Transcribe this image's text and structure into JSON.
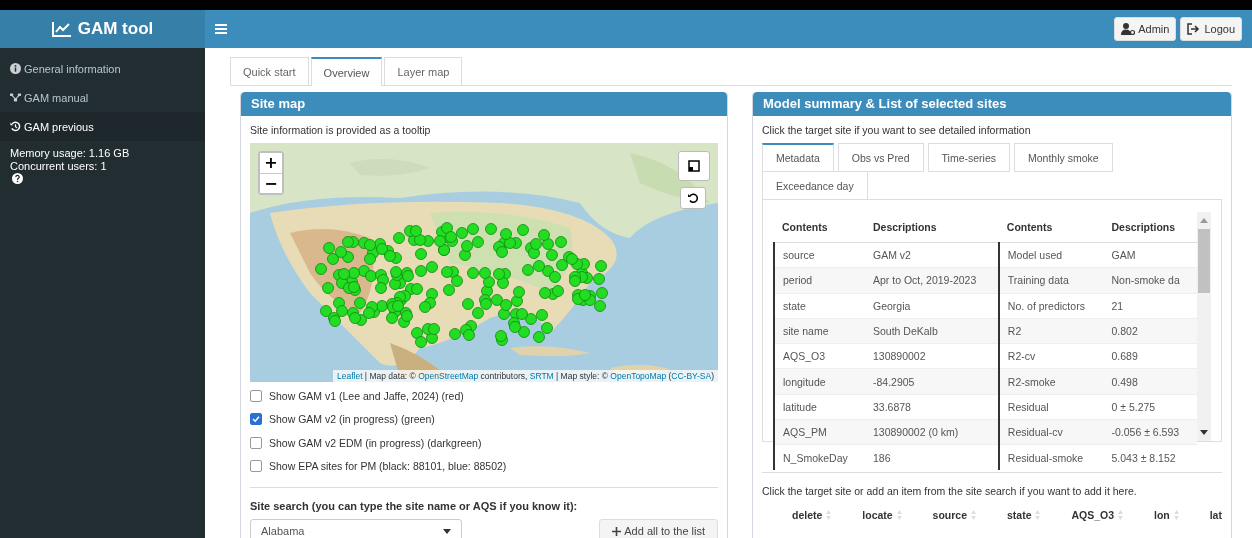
{
  "app": {
    "title": "GAM tool"
  },
  "header": {
    "buttons": [
      {
        "kind": "admin",
        "label": "Admin"
      },
      {
        "kind": "logout",
        "label": "Logou"
      }
    ]
  },
  "sidebar": {
    "items": [
      {
        "kind": "info",
        "label": "General information",
        "selected": false
      },
      {
        "kind": "manual",
        "label": "GAM manual",
        "selected": false
      },
      {
        "kind": "history",
        "label": "GAM previous",
        "selected": true
      }
    ],
    "memory_usage": "Memory usage: 1.16 GB",
    "concurrent_users": "Concurrent users: 1"
  },
  "tabs": [
    {
      "label": "Quick start",
      "selected": false
    },
    {
      "label": "Overview",
      "selected": true
    },
    {
      "label": "Layer map",
      "selected": false
    }
  ],
  "site_map": {
    "title": "Site map",
    "subtitle": "Site information is provided as a tooltip",
    "zoom_in": "+",
    "zoom_out": "−",
    "attribution": [
      {
        "text": "Leaflet",
        "link": true
      },
      {
        "text": " | Map data: © ",
        "link": false
      },
      {
        "text": "OpenStreetMap",
        "link": true
      },
      {
        "text": " contributors, ",
        "link": false
      },
      {
        "text": "SRTM",
        "link": true
      },
      {
        "text": " | Map style: © ",
        "link": false
      },
      {
        "text": "OpenTopoMap",
        "link": true
      },
      {
        "text": " (",
        "link": false
      },
      {
        "text": "CC-BY-SA",
        "link": true
      },
      {
        "text": ")",
        "link": false
      }
    ],
    "layers": [
      {
        "label": "Show GAM v1 (Lee and Jaffe, 2024) (red)",
        "checked": false
      },
      {
        "label": "Show GAM v2 (in progress) (green)",
        "checked": true
      },
      {
        "label": "Show GAM v2 EDM (in progress) (darkgreen)",
        "checked": false
      },
      {
        "label": "Show EPA sites for PM (black: 88101, blue: 88502)",
        "checked": false
      }
    ],
    "search_label": "Site search (you can type the site name or AQS if you know it):",
    "search_select": {
      "value": "Alabama"
    },
    "add_button": "Add all to the list"
  },
  "model_summary": {
    "title": "Model summary & List of selected sites",
    "subtitle": "Click the target site if you want to see detailed information",
    "tabs": [
      {
        "label": "Metadata",
        "selected": true
      },
      {
        "label": "Obs vs Pred",
        "selected": false
      },
      {
        "label": "Time-series",
        "selected": false
      },
      {
        "label": "Monthly smoke",
        "selected": false
      },
      {
        "label": "Exceedance day",
        "selected": false
      }
    ],
    "table": {
      "columns": [
        "Contents",
        "Descriptions",
        "Contents",
        "Descriptions"
      ],
      "rows": [
        [
          "source",
          "GAM v2",
          "Model used",
          "GAM"
        ],
        [
          "period",
          "Apr to Oct, 2019-2023",
          "Training data",
          "Non-smoke da"
        ],
        [
          "state",
          "Georgia",
          "No. of predictors",
          "21"
        ],
        [
          "site name",
          "South DeKalb",
          "R2",
          "0.802"
        ],
        [
          "AQS_O3",
          "130890002",
          "R2-cv",
          "0.689"
        ],
        [
          "longitude",
          "-84.2905",
          "R2-smoke",
          "0.498"
        ],
        [
          "latitude",
          "33.6878",
          "Residual",
          "0 ± 5.275"
        ],
        [
          "AQS_PM",
          "130890002 (0 km)",
          "Residual-cv",
          "-0.056 ± 6.593"
        ],
        [
          "N_SmokeDay",
          "186",
          "Residual-smoke",
          "5.043 ± 8.152"
        ]
      ]
    },
    "list_hint": "Click the target site or add an item from the site search if you want to add it here.",
    "list_columns": [
      "delete",
      "locate",
      "source",
      "state",
      "AQS_O3",
      "lon",
      "lat"
    ]
  }
}
